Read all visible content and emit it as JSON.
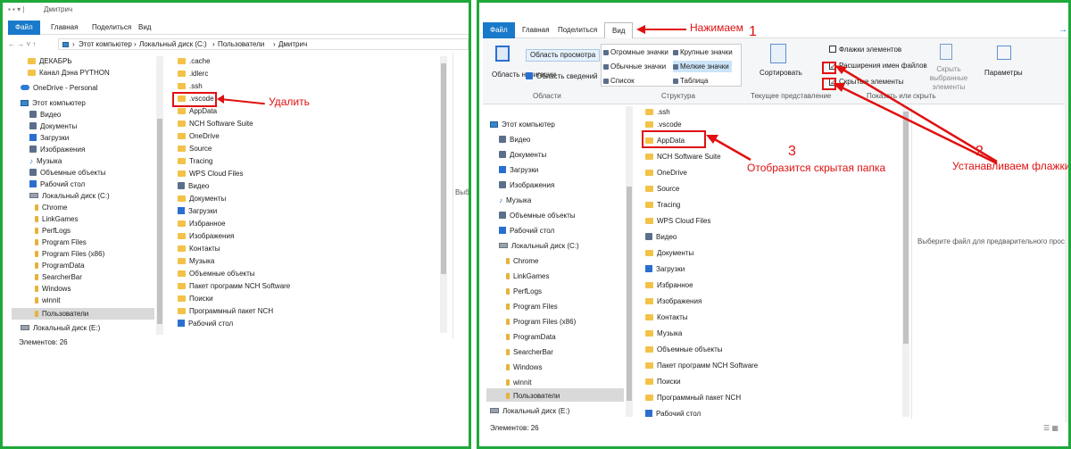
{
  "left": {
    "title": "Дмитрич",
    "tabs": [
      "Файл",
      "Главная",
      "Поделиться",
      "Вид"
    ],
    "breadcrumb": [
      "Этот компьютер",
      "Локальный диск (C:)",
      "Пользователи",
      "Дмитрич"
    ],
    "nav": [
      "ДЕКАБРЬ",
      "Канал Дэна PYTHON",
      "OneDrive - Personal",
      "Этот компьютер",
      "Видео",
      "Документы",
      "Загрузки",
      "Изображения",
      "Музыка",
      "Объемные объекты",
      "Рабочий стол",
      "Локальный диск (C:)",
      "Chrome",
      "LinkGames",
      "PerfLogs",
      "Program Files",
      "Program Files (x86)",
      "ProgramData",
      "SearcherBar",
      "Windows",
      "winnit",
      "Пользователи",
      "Локальный диск (E:)"
    ],
    "files": [
      ".cache",
      ".idlerc",
      ".ssh",
      ".vscode",
      "AppData",
      "NCH Software Suite",
      "OneDrive",
      "Source",
      "Tracing",
      "WPS Cloud Files",
      "Видео",
      "Документы",
      "Загрузки",
      "Избранное",
      "Изображения",
      "Контакты",
      "Музыка",
      "Объемные объекты",
      "Пакет программ NCH Software",
      "Поиски",
      "Программный пакет NCH",
      "Рабочий стол"
    ],
    "status": "Элементов: 26",
    "preview_stub": "Выберите",
    "annotation": "Удалить"
  },
  "right": {
    "tabs": [
      "Файл",
      "Главная",
      "Поделиться",
      "Вид"
    ],
    "ribbon": {
      "nav_pane": "Область навигации",
      "preview_pane": "Область просмотра",
      "details_pane": "Область сведений",
      "group_areas": "Области",
      "layout_items": [
        "Огромные значки",
        "Крупные значки",
        "Обычные значки",
        "Мелкие значки",
        "Список",
        "Таблица"
      ],
      "group_layout": "Структура",
      "sort": "Сортировать",
      "group_current": "Текущее представление",
      "chk_items": "Флажки элементов",
      "chk_ext": "Расширения имен файлов",
      "chk_hidden": "Скрытые элементы",
      "hide_selected": "Скрыть выбранные элементы",
      "group_showhide": "Показать или скрыть",
      "params": "Параметры"
    },
    "nav": [
      "Этот компьютер",
      "Видео",
      "Документы",
      "Загрузки",
      "Изображения",
      "Музыка",
      "Объемные объекты",
      "Рабочий стол",
      "Локальный диск (C:)",
      "Chrome",
      "LinkGames",
      "PerfLogs",
      "Program Files",
      "Program Files (x86)",
      "ProgramData",
      "SearcherBar",
      "Windows",
      "winnit",
      "Пользователи",
      "Локальный диск (E:)"
    ],
    "files": [
      ".ssh",
      ".vscode",
      "AppData",
      "NCH Software Suite",
      "OneDrive",
      "Source",
      "Tracing",
      "WPS Cloud Files",
      "Видео",
      "Документы",
      "Загрузки",
      "Избранное",
      "Изображения",
      "Контакты",
      "Музыка",
      "Объемные объекты",
      "Пакет программ NCH Software",
      "Поиски",
      "Программный пакет NCH",
      "Рабочий стол"
    ],
    "status": "Элементов: 26",
    "preview_text": "Выберите файл для предварительного просмотра.",
    "annotations": {
      "n1": "1",
      "a1": "Нажимаем",
      "n2": "2",
      "a2": "Устанавливаем флажки",
      "n3": "3",
      "a3": "Отобразится скрытая папка"
    }
  },
  "colors": {
    "accent": "#1979ca",
    "frame": "#1fa83b",
    "annotation": "#e01010"
  }
}
